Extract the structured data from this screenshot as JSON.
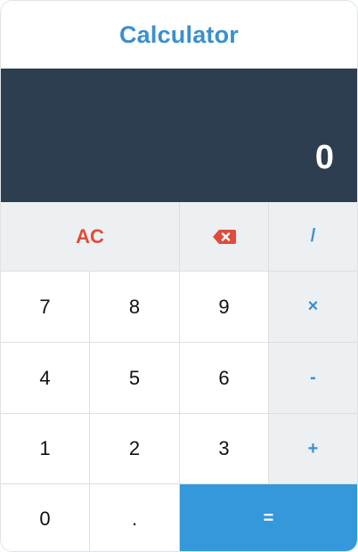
{
  "app": {
    "title": "Calculator"
  },
  "display": {
    "value": "0"
  },
  "keys": {
    "clear": "AC",
    "backspace_icon": "backspace-icon",
    "divide": "/",
    "multiply": "×",
    "subtract": "-",
    "add": "+",
    "equals": "=",
    "decimal": ".",
    "digits": [
      "0",
      "1",
      "2",
      "3",
      "4",
      "5",
      "6",
      "7",
      "8",
      "9"
    ]
  },
  "colors": {
    "accent": "#3a8fd0",
    "display_bg": "#2c3e50",
    "clear_text": "#e14b3b",
    "equals_bg": "#3498db",
    "function_key_bg": "#edf0f2"
  }
}
